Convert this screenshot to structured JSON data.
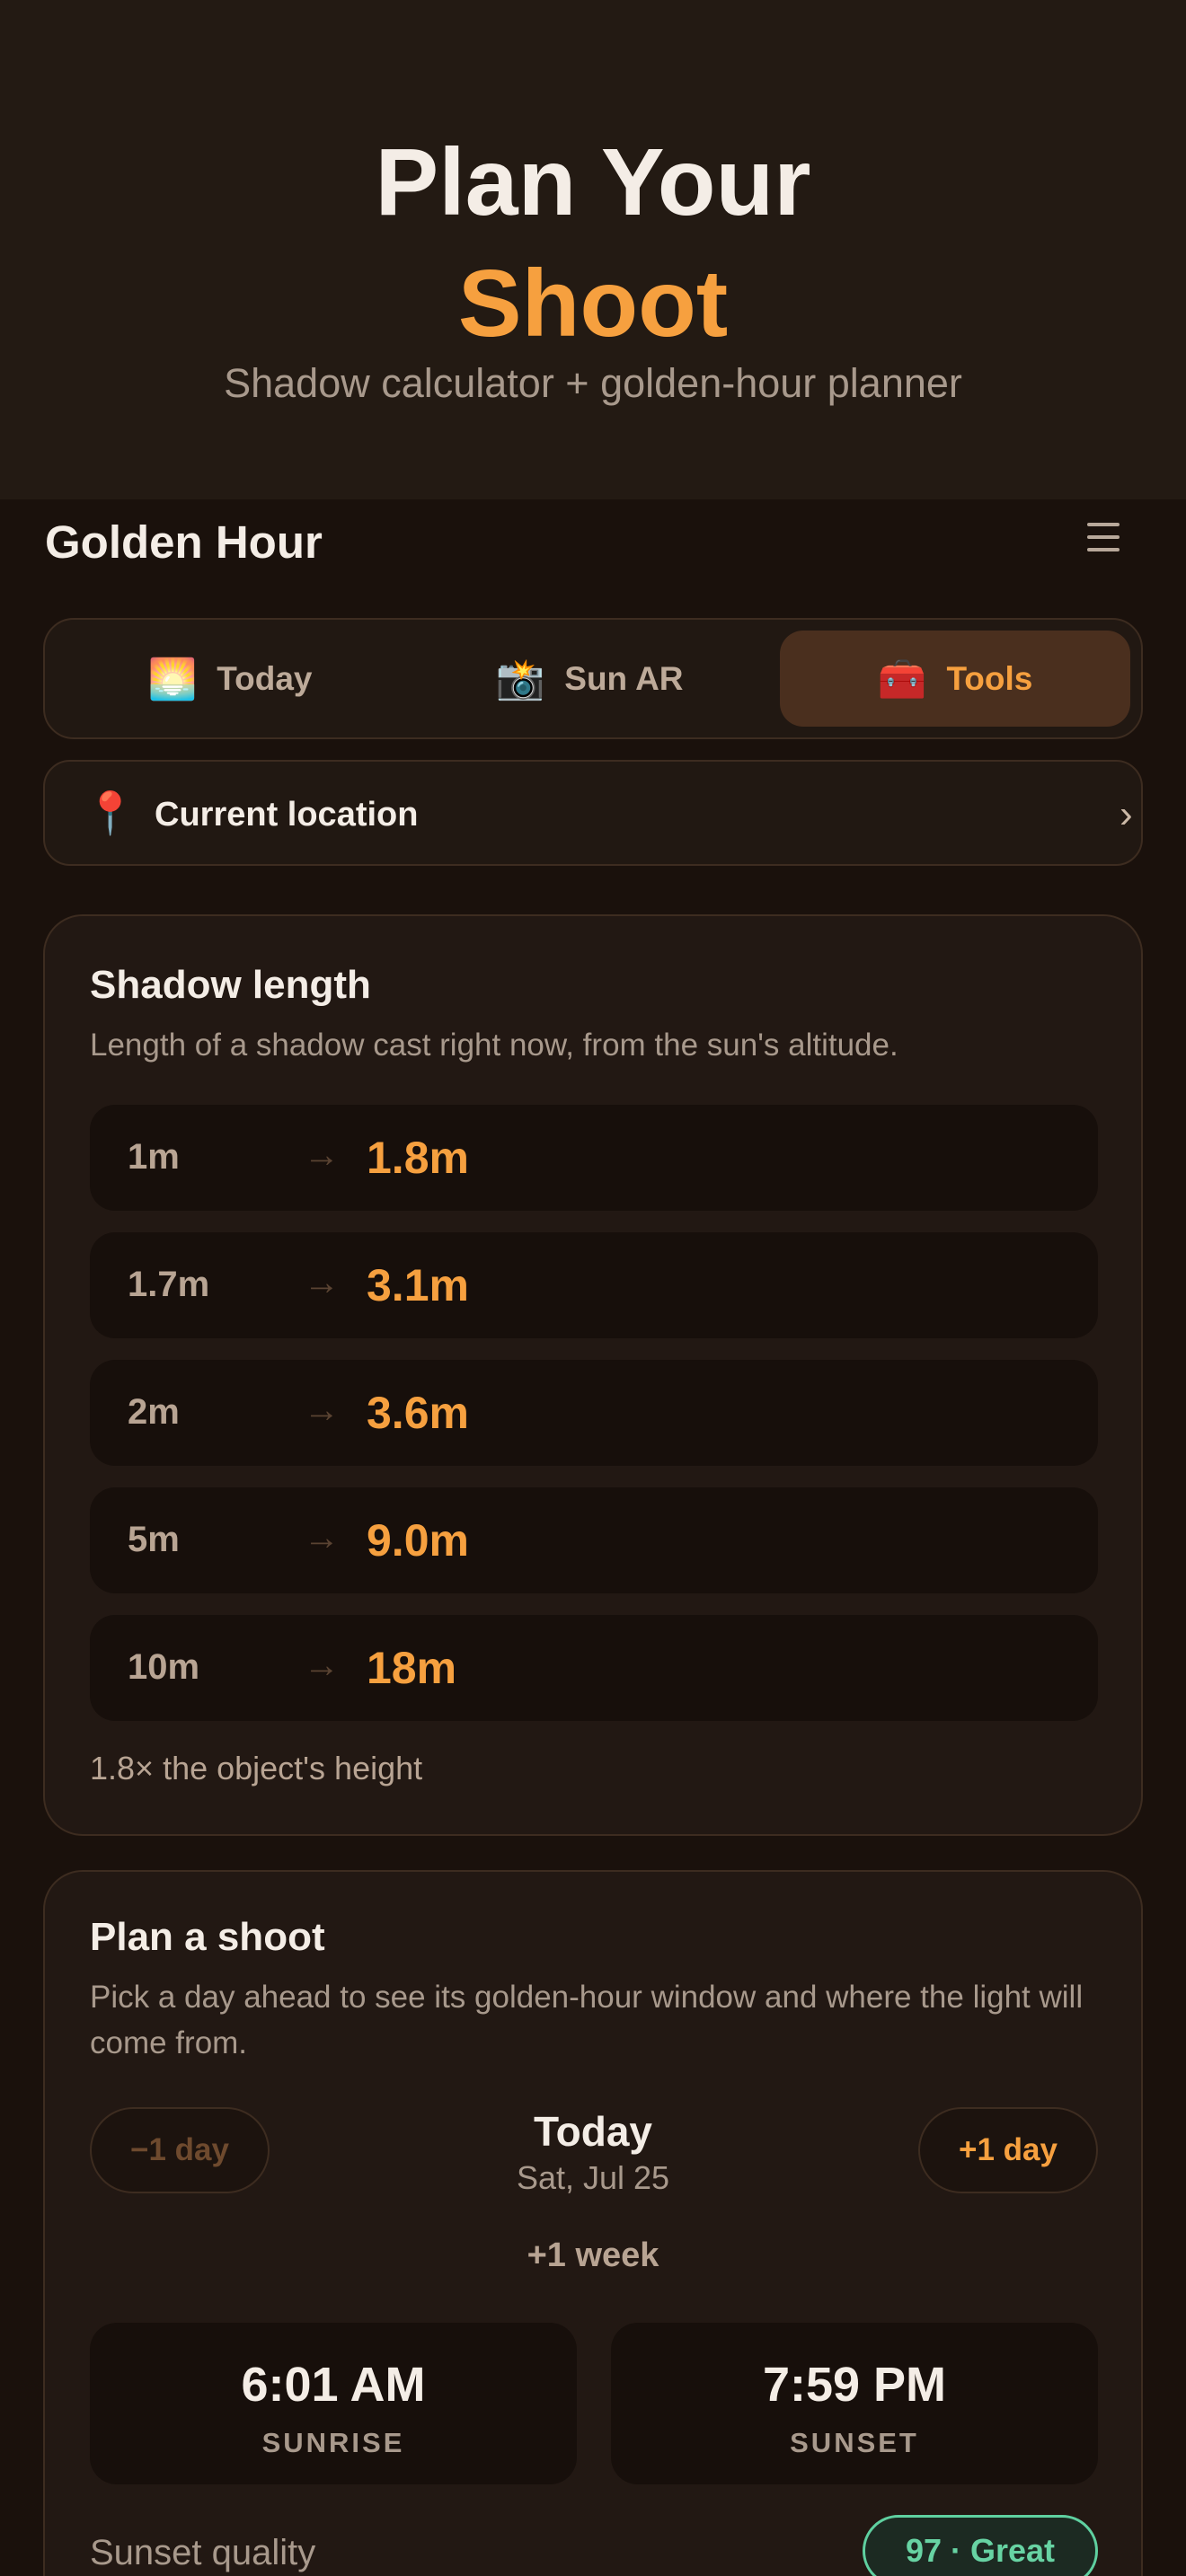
{
  "hero": {
    "title_line1": "Plan Your",
    "title_line2": "Shoot",
    "subtitle": "Shadow calculator + golden-hour planner"
  },
  "header": {
    "app_title": "Golden Hour",
    "menu_icon": "hamburger-menu-icon"
  },
  "tabs": [
    {
      "label": "Today",
      "icon": "🌅",
      "active": false
    },
    {
      "label": "Sun AR",
      "icon": "📸",
      "active": false
    },
    {
      "label": "Tools",
      "icon": "🧰",
      "active": true
    }
  ],
  "location": {
    "icon": "📍",
    "label": "Current location",
    "chevron": "›"
  },
  "shadow_card": {
    "title": "Shadow length",
    "description": "Length of a shadow cast right now, from the sun's altitude.",
    "arrow": "→",
    "rows": [
      {
        "object": "1m",
        "shadow": "1.8m"
      },
      {
        "object": "1.7m",
        "shadow": "3.1m"
      },
      {
        "object": "2m",
        "shadow": "3.6m"
      },
      {
        "object": "5m",
        "shadow": "9.0m"
      },
      {
        "object": "10m",
        "shadow": "18m"
      }
    ],
    "ratio_text": "1.8× the object's height"
  },
  "plan_card": {
    "title": "Plan a shoot",
    "description": "Pick a day ahead to see its golden-hour window and where the light will come from.",
    "prev_day": "−1 day",
    "next_day": "+1 day",
    "day_title": "Today",
    "day_date": "Sat, Jul 25",
    "week_link": "+1 week",
    "sunrise_time": "6:01 AM",
    "sunrise_label": "SUNRISE",
    "sunset_time": "7:59 PM",
    "sunset_label": "SUNSET",
    "quality_label": "Sunset quality",
    "quality_badge": "97 · Great"
  },
  "colors": {
    "accent": "#f6a03f",
    "background": "#1a110c",
    "card": "#221813",
    "good": "#67d3a3"
  }
}
